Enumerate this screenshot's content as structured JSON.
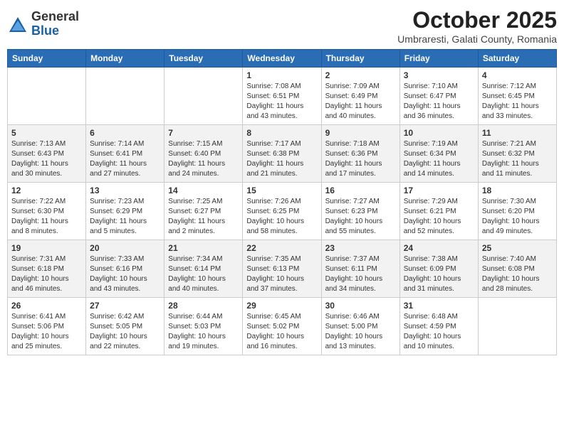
{
  "header": {
    "logo": {
      "general": "General",
      "blue": "Blue"
    },
    "title": "October 2025",
    "subtitle": "Umbraresti, Galati County, Romania"
  },
  "weekdays": [
    "Sunday",
    "Monday",
    "Tuesday",
    "Wednesday",
    "Thursday",
    "Friday",
    "Saturday"
  ],
  "rows": [
    [
      {
        "num": "",
        "info": ""
      },
      {
        "num": "",
        "info": ""
      },
      {
        "num": "",
        "info": ""
      },
      {
        "num": "1",
        "info": "Sunrise: 7:08 AM\nSunset: 6:51 PM\nDaylight: 11 hours and 43 minutes."
      },
      {
        "num": "2",
        "info": "Sunrise: 7:09 AM\nSunset: 6:49 PM\nDaylight: 11 hours and 40 minutes."
      },
      {
        "num": "3",
        "info": "Sunrise: 7:10 AM\nSunset: 6:47 PM\nDaylight: 11 hours and 36 minutes."
      },
      {
        "num": "4",
        "info": "Sunrise: 7:12 AM\nSunset: 6:45 PM\nDaylight: 11 hours and 33 minutes."
      }
    ],
    [
      {
        "num": "5",
        "info": "Sunrise: 7:13 AM\nSunset: 6:43 PM\nDaylight: 11 hours and 30 minutes."
      },
      {
        "num": "6",
        "info": "Sunrise: 7:14 AM\nSunset: 6:41 PM\nDaylight: 11 hours and 27 minutes."
      },
      {
        "num": "7",
        "info": "Sunrise: 7:15 AM\nSunset: 6:40 PM\nDaylight: 11 hours and 24 minutes."
      },
      {
        "num": "8",
        "info": "Sunrise: 7:17 AM\nSunset: 6:38 PM\nDaylight: 11 hours and 21 minutes."
      },
      {
        "num": "9",
        "info": "Sunrise: 7:18 AM\nSunset: 6:36 PM\nDaylight: 11 hours and 17 minutes."
      },
      {
        "num": "10",
        "info": "Sunrise: 7:19 AM\nSunset: 6:34 PM\nDaylight: 11 hours and 14 minutes."
      },
      {
        "num": "11",
        "info": "Sunrise: 7:21 AM\nSunset: 6:32 PM\nDaylight: 11 hours and 11 minutes."
      }
    ],
    [
      {
        "num": "12",
        "info": "Sunrise: 7:22 AM\nSunset: 6:30 PM\nDaylight: 11 hours and 8 minutes."
      },
      {
        "num": "13",
        "info": "Sunrise: 7:23 AM\nSunset: 6:29 PM\nDaylight: 11 hours and 5 minutes."
      },
      {
        "num": "14",
        "info": "Sunrise: 7:25 AM\nSunset: 6:27 PM\nDaylight: 11 hours and 2 minutes."
      },
      {
        "num": "15",
        "info": "Sunrise: 7:26 AM\nSunset: 6:25 PM\nDaylight: 10 hours and 58 minutes."
      },
      {
        "num": "16",
        "info": "Sunrise: 7:27 AM\nSunset: 6:23 PM\nDaylight: 10 hours and 55 minutes."
      },
      {
        "num": "17",
        "info": "Sunrise: 7:29 AM\nSunset: 6:21 PM\nDaylight: 10 hours and 52 minutes."
      },
      {
        "num": "18",
        "info": "Sunrise: 7:30 AM\nSunset: 6:20 PM\nDaylight: 10 hours and 49 minutes."
      }
    ],
    [
      {
        "num": "19",
        "info": "Sunrise: 7:31 AM\nSunset: 6:18 PM\nDaylight: 10 hours and 46 minutes."
      },
      {
        "num": "20",
        "info": "Sunrise: 7:33 AM\nSunset: 6:16 PM\nDaylight: 10 hours and 43 minutes."
      },
      {
        "num": "21",
        "info": "Sunrise: 7:34 AM\nSunset: 6:14 PM\nDaylight: 10 hours and 40 minutes."
      },
      {
        "num": "22",
        "info": "Sunrise: 7:35 AM\nSunset: 6:13 PM\nDaylight: 10 hours and 37 minutes."
      },
      {
        "num": "23",
        "info": "Sunrise: 7:37 AM\nSunset: 6:11 PM\nDaylight: 10 hours and 34 minutes."
      },
      {
        "num": "24",
        "info": "Sunrise: 7:38 AM\nSunset: 6:09 PM\nDaylight: 10 hours and 31 minutes."
      },
      {
        "num": "25",
        "info": "Sunrise: 7:40 AM\nSunset: 6:08 PM\nDaylight: 10 hours and 28 minutes."
      }
    ],
    [
      {
        "num": "26",
        "info": "Sunrise: 6:41 AM\nSunset: 5:06 PM\nDaylight: 10 hours and 25 minutes."
      },
      {
        "num": "27",
        "info": "Sunrise: 6:42 AM\nSunset: 5:05 PM\nDaylight: 10 hours and 22 minutes."
      },
      {
        "num": "28",
        "info": "Sunrise: 6:44 AM\nSunset: 5:03 PM\nDaylight: 10 hours and 19 minutes."
      },
      {
        "num": "29",
        "info": "Sunrise: 6:45 AM\nSunset: 5:02 PM\nDaylight: 10 hours and 16 minutes."
      },
      {
        "num": "30",
        "info": "Sunrise: 6:46 AM\nSunset: 5:00 PM\nDaylight: 10 hours and 13 minutes."
      },
      {
        "num": "31",
        "info": "Sunrise: 6:48 AM\nSunset: 4:59 PM\nDaylight: 10 hours and 10 minutes."
      },
      {
        "num": "",
        "info": ""
      }
    ]
  ]
}
